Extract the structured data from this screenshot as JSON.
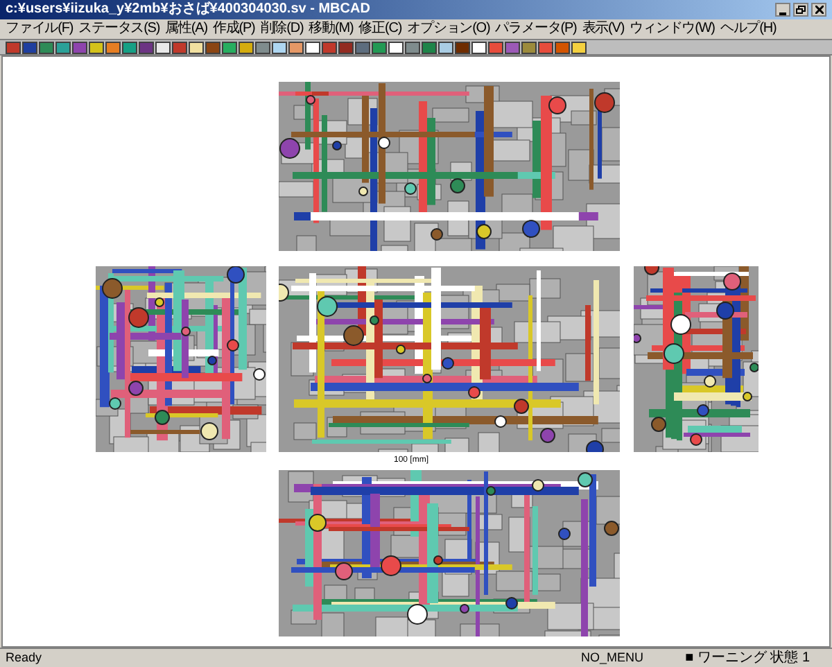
{
  "window": {
    "title": "c:¥users¥iizuka_y¥2mb¥おさば¥400304030.sv - MBCAD"
  },
  "menu": [
    "ファイル(F)",
    "ステータス(S)",
    "属性(A)",
    "作成(P)",
    "削除(D)",
    "移動(M)",
    "修正(C)",
    "オプション(O)",
    "パラメータ(P)",
    "表示(V)",
    "ウィンドウ(W)",
    "ヘルプ(H)"
  ],
  "palette": [
    {
      "color": "#c0392b"
    },
    {
      "color": "#1f3f9f"
    },
    {
      "color": "#2e8b57"
    },
    {
      "color": "#2aa198"
    },
    {
      "color": "#8e44ad"
    },
    {
      "color": "#d4c21a"
    },
    {
      "color": "#e67e22"
    },
    {
      "color": "#16a085"
    },
    {
      "color": "#6c3483"
    },
    {
      "color": "#e8e8e8"
    },
    {
      "color": "#c0392b"
    },
    {
      "color": "#f1e0a0"
    },
    {
      "color": "#8b4513"
    },
    {
      "color": "#27ae60"
    },
    {
      "color": "#d4ac0d"
    },
    {
      "color": "#7f8c8d"
    },
    {
      "color": "#aed6f1"
    },
    {
      "color": "#e59866"
    },
    {
      "color": "#ffffff"
    },
    {
      "color": "#c0392b"
    },
    {
      "color": "#922b21"
    },
    {
      "color": "#5d6d7e"
    },
    {
      "color": "#229954"
    },
    {
      "color": "#ffffff"
    },
    {
      "color": "#7f8c8d"
    },
    {
      "color": "#1e8449"
    },
    {
      "color": "#a9cce3"
    },
    {
      "color": "#6e2c00"
    },
    {
      "color": "#ffffff"
    },
    {
      "color": "#e74c3c"
    },
    {
      "color": "#9b59b6"
    },
    {
      "color": "#9c8b3c"
    },
    {
      "color": "#e74c3c"
    },
    {
      "color": "#d35400"
    },
    {
      "color": "#f4d03f"
    }
  ],
  "canvas": {
    "dimension_label": "100 [mm]"
  },
  "status_bar": {
    "message": "Ready",
    "mode": "NO_MENU",
    "warning": "■ ワーニング 状態 1"
  }
}
